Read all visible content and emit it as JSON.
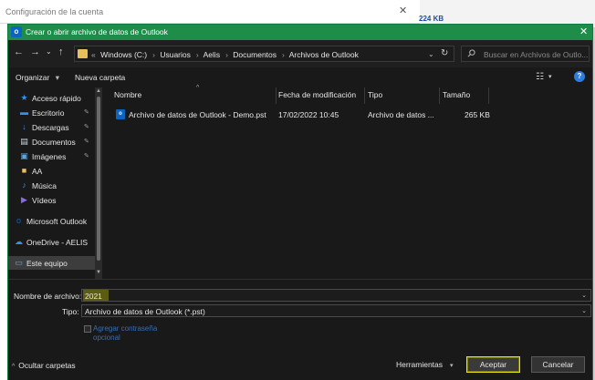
{
  "background": {
    "title": "Configuración de la cuenta",
    "close": "✕",
    "size_text": "224 KB"
  },
  "dialog": {
    "app_icon": "o",
    "title": "Crear o abrir archivo de datos de Outlook",
    "close": "✕",
    "accent_color": "#1e8d4a"
  },
  "nav": {
    "back": "←",
    "forward": "→",
    "dropdown": "⌄",
    "up": "↑",
    "crumb_prefix": "«",
    "crumbs": [
      "Windows (C:)",
      "Usuarios",
      "Aelis",
      "Documentos",
      "Archivos de Outlook"
    ],
    "crumb_sep": "›",
    "address_dropdown": "⌄",
    "refresh": "↻",
    "search_placeholder": "Buscar en Archivos de Outlo..."
  },
  "toolbar": {
    "organize": "Organizar",
    "organize_arrow": "▾",
    "new_folder": "Nueva carpeta",
    "view_icon": "☷",
    "view_dropdown": "▾",
    "help": "?"
  },
  "sidebar": {
    "items": [
      {
        "label": "Acceso rápido",
        "icon": "star-icon",
        "glyph": "★",
        "color": "#3a8ee6",
        "pinned": false
      },
      {
        "label": "Escritorio",
        "icon": "desktop-icon",
        "glyph": "▬",
        "color": "#3a8ee6",
        "pinned": true
      },
      {
        "label": "Descargas",
        "icon": "download-icon",
        "glyph": "↓",
        "color": "#3a8ee6",
        "pinned": true
      },
      {
        "label": "Documentos",
        "icon": "document-icon",
        "glyph": "▤",
        "color": "#cfd8e6",
        "pinned": true
      },
      {
        "label": "Imágenes",
        "icon": "image-icon",
        "glyph": "▣",
        "color": "#5aa7e6",
        "pinned": true
      },
      {
        "label": "AA",
        "icon": "folder-icon",
        "glyph": "■",
        "color": "#e6c05a",
        "pinned": false
      },
      {
        "label": "Música",
        "icon": "music-icon",
        "glyph": "♪",
        "color": "#3a8ee6",
        "pinned": false
      },
      {
        "label": "Vídeos",
        "icon": "video-icon",
        "glyph": "▶",
        "color": "#8a6ae6",
        "pinned": false
      },
      {
        "label": "Microsoft Outlook",
        "icon": "outlook-icon",
        "glyph": "o",
        "color": "#0a64c2",
        "pinned": false
      },
      {
        "label": "OneDrive - AELIS",
        "icon": "cloud-icon",
        "glyph": "☁",
        "color": "#3a8ee6",
        "pinned": false
      },
      {
        "label": "Este equipo",
        "icon": "computer-icon",
        "glyph": "▭",
        "color": "#5aa7e6",
        "pinned": false
      }
    ],
    "pin_glyph": "✎"
  },
  "filelist": {
    "columns": [
      "Nombre",
      "Fecha de modificación",
      "Tipo",
      "Tamaño"
    ],
    "sort_arrow": "^",
    "rows": [
      {
        "name": "Archivo de datos de Outlook - Demo.pst",
        "date": "17/02/2022 10:45",
        "type": "Archivo de datos ...",
        "size": "265 KB"
      }
    ]
  },
  "form": {
    "filename_label": "Nombre de archivo:",
    "filename_value": "2021",
    "type_label": "Tipo:",
    "type_value": "Archivo de datos de Outlook (*.pst)",
    "dropdown_glyph": "⌄",
    "checkbox_label_1": "Agregar contraseña",
    "checkbox_label_2": "opcional"
  },
  "footer": {
    "hide_folders": "Ocultar carpetas",
    "hide_arrow": "^",
    "tools": "Herramientas",
    "tools_arrow": "▾",
    "accept": "Aceptar",
    "cancel": "Cancelar"
  }
}
